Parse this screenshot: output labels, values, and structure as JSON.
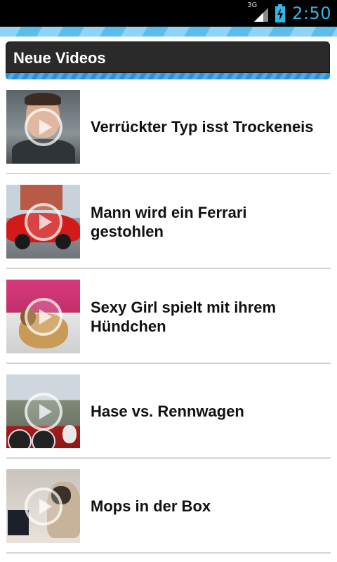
{
  "status_bar": {
    "network_type": "3G",
    "time": "2:50",
    "icons": [
      "signal-icon",
      "battery-charging-icon"
    ]
  },
  "header": {
    "title": "Neue Videos"
  },
  "videos": [
    {
      "title": "Verrückter Typ isst Trockeneis",
      "thumb_icon": "play-icon"
    },
    {
      "title": "Mann wird ein Ferrari gestohlen",
      "thumb_icon": "play-icon"
    },
    {
      "title": "Sexy Girl spielt mit ihrem Hündchen",
      "thumb_icon": "play-icon"
    },
    {
      "title": "Hase vs. Rennwagen",
      "thumb_icon": "play-icon"
    },
    {
      "title": "Mops in der Box",
      "thumb_icon": "play-icon"
    }
  ],
  "colors": {
    "status_bar_bg": "#000000",
    "clock": "#33b5e5",
    "accent": "#33b5e5",
    "header_bg": "#2a2a2a",
    "title_text": "#111111"
  }
}
